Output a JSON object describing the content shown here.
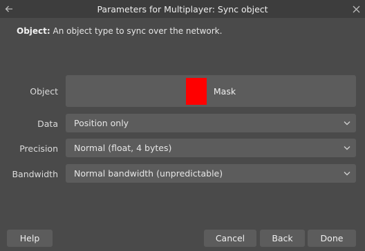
{
  "window": {
    "title": "Parameters for Multiplayer: Sync object",
    "back_icon": "arrow-left-icon",
    "close_icon": "close-icon"
  },
  "description": {
    "term": "Object:",
    "text": "An object type to sync over the network."
  },
  "fields": {
    "object": {
      "label": "Object",
      "value": "Mask",
      "swatch_color": "#ff0000"
    },
    "data": {
      "label": "Data",
      "value": "Position only"
    },
    "precision": {
      "label": "Precision",
      "value": "Normal (float, 4 bytes)"
    },
    "bandwidth": {
      "label": "Bandwidth",
      "value": "Normal bandwidth (unpredictable)"
    }
  },
  "buttons": {
    "help": "Help",
    "cancel": "Cancel",
    "back": "Back",
    "done": "Done"
  }
}
